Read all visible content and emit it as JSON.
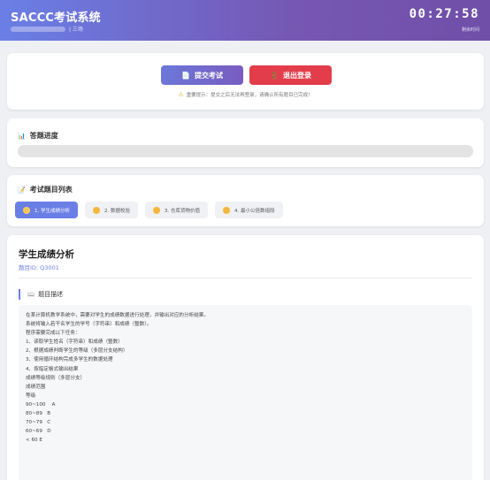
{
  "header": {
    "title": "SACCC考试系统",
    "user_suffix": "| 三场",
    "timer": "00:27:58",
    "timer_label": "剩余时间"
  },
  "actions": {
    "submit_label": "提交考试",
    "submit_icon": "document-icon",
    "logout_label": "退出登录",
    "logout_icon": "door-icon",
    "warning": "重要提示：提交之后无法再登录，请确认所有题目已完成！"
  },
  "progress": {
    "title": "答题进度",
    "value_percent": 0
  },
  "question_list": {
    "title": "考试题目列表",
    "items": [
      {
        "label": "1. 学生成绩分析",
        "active": true
      },
      {
        "label": "2. 数据校验",
        "active": false
      },
      {
        "label": "3. 仓库货物价值",
        "active": false
      },
      {
        "label": "4. 最小公倍数组段",
        "active": false
      }
    ]
  },
  "question": {
    "title": "学生成绩分析",
    "id_text": "题目ID: Q3001",
    "desc_title": "题目描述",
    "lines": [
      "在某计算机教学系统中，需要对学生的成绩数据进行处理，并输出对应的分析结果。",
      "系统将输入若干名学生的学号（字符串）和成绩（整数）。",
      "程序需要完成以下任务：",
      "1、读取学生姓名（字符串）和成绩（整数）",
      "2、根据成绩判断学生的等级（多层分支结构）",
      "3、使用循环结构完成多学生的数据处理",
      "4、按指定格式输出结果",
      "成绩等级规则（多层分支）",
      "成绩范围",
      "等级",
      "90~100    A",
      "80~89   B",
      "70~79   C",
      "60~69   D",
      "< 60 E"
    ]
  }
}
